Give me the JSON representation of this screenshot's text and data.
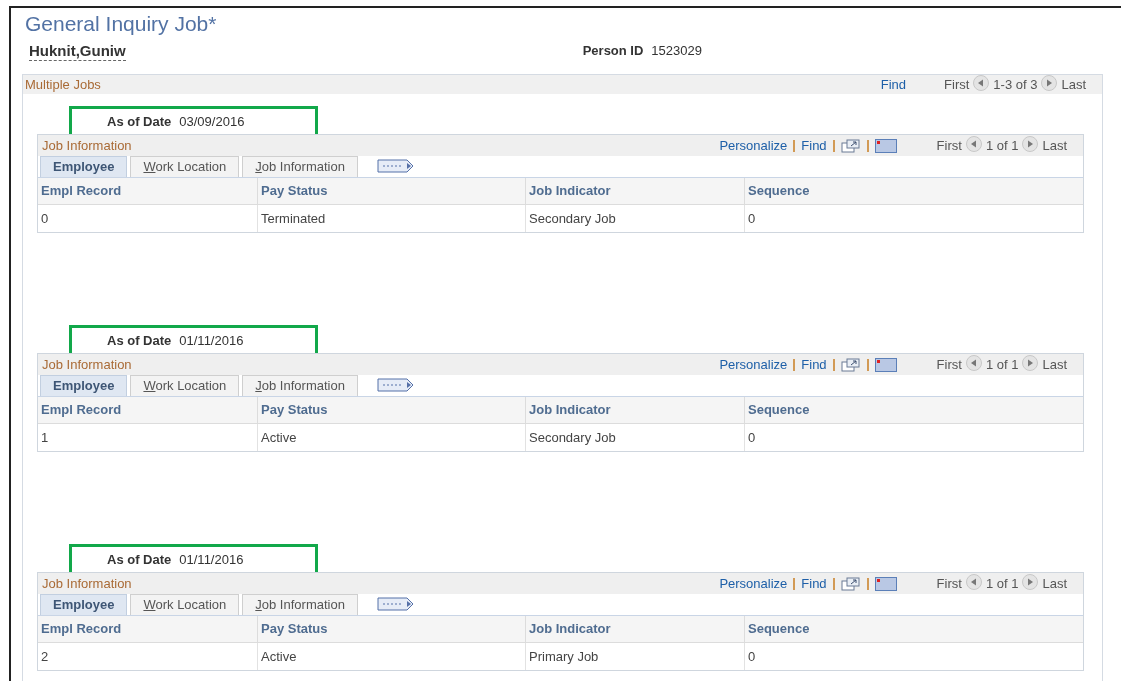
{
  "page_title": "General Inquiry Job*",
  "person": {
    "name": "Huknit,Guniw",
    "id_label": "Person ID",
    "id_value": "1523029"
  },
  "multiple_jobs": {
    "title": "Multiple Jobs",
    "find": "Find",
    "first": "First",
    "range": "1-3 of 3",
    "last": "Last",
    "jobs": [
      {
        "as_of_label": "As of Date",
        "as_of_value": "03/09/2016",
        "highlighted": true,
        "grid_title": "Job Information",
        "personalize": "Personalize",
        "find": "Find",
        "first": "First",
        "range": "1 of 1",
        "last": "Last",
        "tabs": [
          {
            "label": "Employee",
            "selected": true,
            "access_key": false
          },
          {
            "label": "Work Location",
            "selected": false,
            "access_key": true
          },
          {
            "label": "Job Information",
            "selected": false,
            "access_key": true
          }
        ],
        "columns": [
          "Empl Record",
          "Pay Status",
          "Job Indicator",
          "Sequence"
        ],
        "rows": [
          [
            "0",
            "Terminated",
            "Secondary Job",
            "0"
          ]
        ]
      },
      {
        "as_of_label": "As of Date",
        "as_of_value": "01/11/2016",
        "highlighted": true,
        "grid_title": "Job Information",
        "personalize": "Personalize",
        "find": "Find",
        "first": "First",
        "range": "1 of 1",
        "last": "Last",
        "tabs": [
          {
            "label": "Employee",
            "selected": true,
            "access_key": false
          },
          {
            "label": "Work Location",
            "selected": false,
            "access_key": true
          },
          {
            "label": "Job Information",
            "selected": false,
            "access_key": true
          }
        ],
        "columns": [
          "Empl Record",
          "Pay Status",
          "Job Indicator",
          "Sequence"
        ],
        "rows": [
          [
            "1",
            "Active",
            "Secondary Job",
            "0"
          ]
        ]
      },
      {
        "as_of_label": "As of Date",
        "as_of_value": "01/11/2016",
        "highlighted": true,
        "grid_title": "Job Information",
        "personalize": "Personalize",
        "find": "Find",
        "first": "First",
        "range": "1 of 1",
        "last": "Last",
        "tabs": [
          {
            "label": "Employee",
            "selected": true,
            "access_key": false
          },
          {
            "label": "Work Location",
            "selected": false,
            "access_key": true
          },
          {
            "label": "Job Information",
            "selected": false,
            "access_key": true
          }
        ],
        "columns": [
          "Empl Record",
          "Pay Status",
          "Job Indicator",
          "Sequence"
        ],
        "rows": [
          [
            "2",
            "Active",
            "Primary Job",
            "0"
          ]
        ]
      }
    ]
  }
}
